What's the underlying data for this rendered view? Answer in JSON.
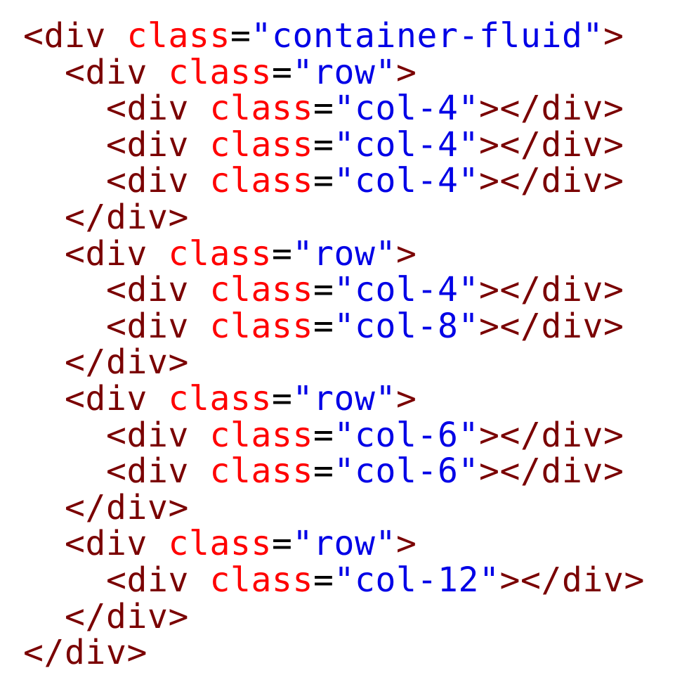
{
  "colors": {
    "tag": "#7a0000",
    "attribute": "#ff0000",
    "equals": "#000000",
    "value": "#0000e6",
    "background": "#ffffff"
  },
  "code_lines": [
    {
      "indent": "",
      "kind": "open",
      "tag": "div",
      "attr": "class",
      "value": "\"container-fluid\""
    },
    {
      "indent": "  ",
      "kind": "open",
      "tag": "div",
      "attr": "class",
      "value": "\"row\""
    },
    {
      "indent": "    ",
      "kind": "pair",
      "tag": "div",
      "attr": "class",
      "value": "\"col-4\""
    },
    {
      "indent": "    ",
      "kind": "pair",
      "tag": "div",
      "attr": "class",
      "value": "\"col-4\""
    },
    {
      "indent": "    ",
      "kind": "pair",
      "tag": "div",
      "attr": "class",
      "value": "\"col-4\""
    },
    {
      "indent": "  ",
      "kind": "close",
      "tag": "div"
    },
    {
      "indent": "  ",
      "kind": "open",
      "tag": "div",
      "attr": "class",
      "value": "\"row\""
    },
    {
      "indent": "    ",
      "kind": "pair",
      "tag": "div",
      "attr": "class",
      "value": "\"col-4\""
    },
    {
      "indent": "    ",
      "kind": "pair",
      "tag": "div",
      "attr": "class",
      "value": "\"col-8\""
    },
    {
      "indent": "  ",
      "kind": "close",
      "tag": "div"
    },
    {
      "indent": "  ",
      "kind": "open",
      "tag": "div",
      "attr": "class",
      "value": "\"row\""
    },
    {
      "indent": "    ",
      "kind": "pair",
      "tag": "div",
      "attr": "class",
      "value": "\"col-6\""
    },
    {
      "indent": "    ",
      "kind": "pair",
      "tag": "div",
      "attr": "class",
      "value": "\"col-6\""
    },
    {
      "indent": "  ",
      "kind": "close",
      "tag": "div"
    },
    {
      "indent": "  ",
      "kind": "open",
      "tag": "div",
      "attr": "class",
      "value": "\"row\""
    },
    {
      "indent": "    ",
      "kind": "pair",
      "tag": "div",
      "attr": "class",
      "value": "\"col-12\""
    },
    {
      "indent": "  ",
      "kind": "close",
      "tag": "div"
    },
    {
      "indent": "",
      "kind": "close",
      "tag": "div"
    }
  ]
}
